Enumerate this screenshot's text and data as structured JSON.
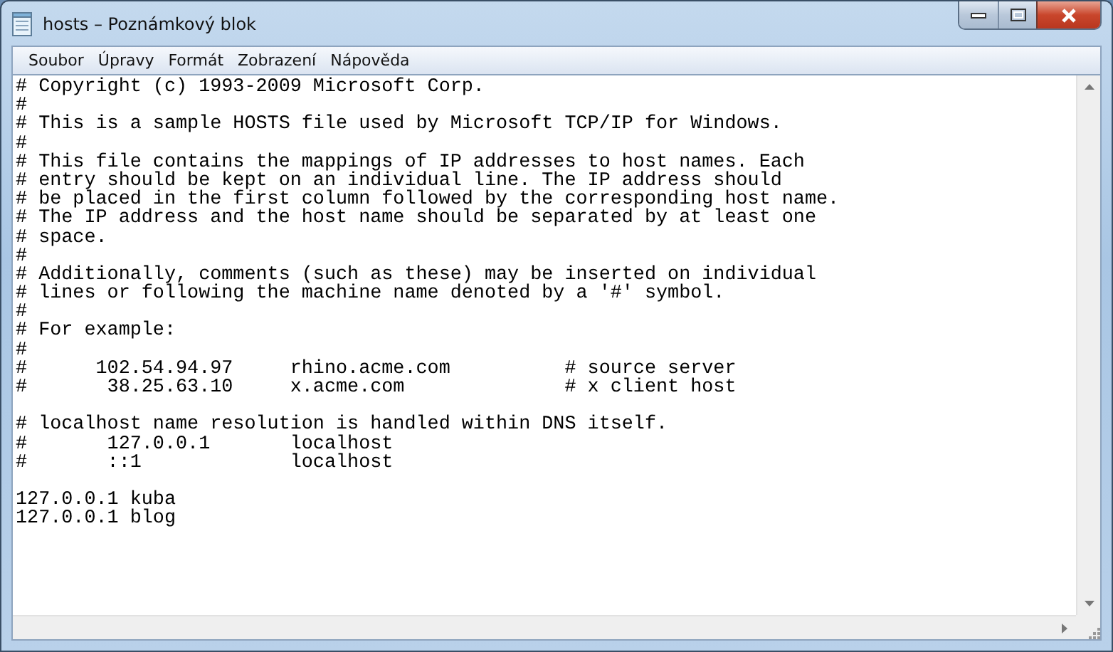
{
  "window": {
    "title": "hosts – Poznámkový blok"
  },
  "menu": [
    "Soubor",
    "Úpravy",
    "Formát",
    "Zobrazení",
    "Nápověda"
  ],
  "lines": [
    {
      "text": "# Copyright (c) 1993-2009 Microsoft Corp."
    },
    {
      "text": "#"
    },
    {
      "text": "# This is a sample HOSTS file used by Microsoft TCP/IP for Windows."
    },
    {
      "text": "#"
    },
    {
      "text": "# This file contains the mappings of IP addresses to host names. Each"
    },
    {
      "text": "# entry should be kept on an individual line. The IP address should"
    },
    {
      "text": "# be placed in the first column followed by the corresponding host name."
    },
    {
      "text": "# The IP address and the host name should be separated by at least one"
    },
    {
      "text": "# space."
    },
    {
      "text": "#"
    },
    {
      "text": "# Additionally, comments (such as these) may be inserted on individual"
    },
    {
      "text": "# lines or following the machine name denoted by a '#' symbol."
    },
    {
      "text": "#"
    },
    {
      "text": "# For example:"
    },
    {
      "text": "#"
    },
    {
      "text": "#      102.54.94.97     rhino.acme.com          # source server"
    },
    {
      "text": "#       38.25.63.10     x.acme.com              # x client host"
    },
    {
      "text": "# localhost name resolution is handled within DNS itself.",
      "blank_before": true
    },
    {
      "text": "#       127.0.0.1       localhost"
    },
    {
      "text": "#       ::1             localhost"
    },
    {
      "text": "127.0.0.1 kuba",
      "blank_before": true
    },
    {
      "text": "127.0.0.1 blog"
    }
  ]
}
